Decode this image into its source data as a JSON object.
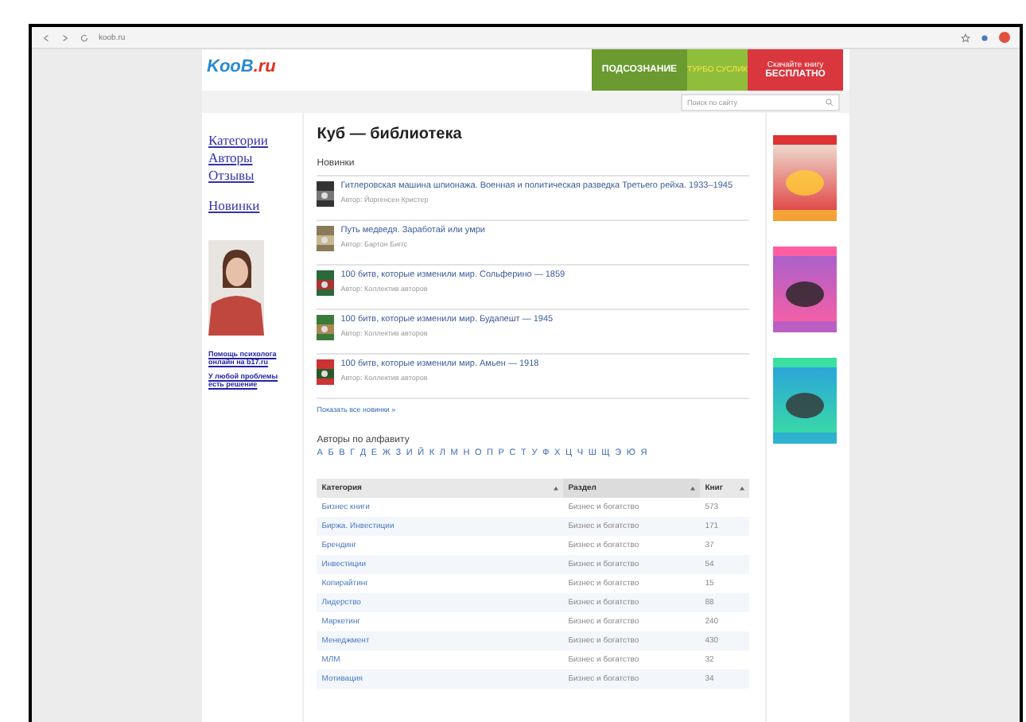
{
  "browser": {
    "url": "koob.ru"
  },
  "header": {
    "logo_main": "KooB",
    "logo_suffix": ".ru",
    "banner": {
      "tagline": "ПОДСОЗНАНИЕ",
      "middle": "ТУРБО СУСЛИК",
      "cta_line1": "Скачайте книгу",
      "cta_line2": "БЕСПЛАТНО"
    }
  },
  "search": {
    "placeholder": "Поиск по сайту"
  },
  "sidebar": {
    "links": [
      "Категории",
      "Авторы",
      "Отзывы"
    ],
    "news_link": "Новинки",
    "promo_links": [
      "Помощь психолога онлайн на b17.ru",
      "У любой проблемы есть решение"
    ]
  },
  "main": {
    "title": "Куб — библиотека",
    "news_heading": "Новинки",
    "books": [
      {
        "title": "Гитлеровская машина шпионажа. Военная и политическая разведка Третьего рейха. 1933–1945",
        "author": "Автор: Йоргенсен Кристер"
      },
      {
        "title": "Путь медведя. Заработай или умри",
        "author": "Автор: Бартон Биггс"
      },
      {
        "title": "100 битв, которые изменили мир. Сольферино — 1859",
        "author": "Автор: Коллектив авторов"
      },
      {
        "title": "100 битв, которые изменили мир. Будапешт — 1945",
        "author": "Автор: Коллектив авторов"
      },
      {
        "title": "100 битв, которые изменили мир. Амьен — 1918",
        "author": "Автор: Коллектив авторов"
      }
    ],
    "show_all": "Показать все новинки »",
    "authors_heading": "Авторы по алфавиту",
    "letters": [
      "А",
      "Б",
      "В",
      "Г",
      "Д",
      "Е",
      "Ж",
      "З",
      "И",
      "Й",
      "К",
      "Л",
      "М",
      "Н",
      "О",
      "П",
      "Р",
      "С",
      "Т",
      "У",
      "Ф",
      "Х",
      "Ц",
      "Ч",
      "Ш",
      "Щ",
      "Э",
      "Ю",
      "Я"
    ],
    "table": {
      "columns": [
        "Категория",
        "Раздел",
        "Книг"
      ],
      "rows": [
        [
          "Бизнес книги",
          "Бизнес и богатство",
          "573"
        ],
        [
          "Биржа. Инвестиции",
          "Бизнес и богатство",
          "171"
        ],
        [
          "Брендинг",
          "Бизнес и богатство",
          "37"
        ],
        [
          "Инвестиции",
          "Бизнес и богатство",
          "54"
        ],
        [
          "Копирайтинг",
          "Бизнес и богатство",
          "15"
        ],
        [
          "Лидерство",
          "Бизнес и богатство",
          "88"
        ],
        [
          "Маркетинг",
          "Бизнес и богатство",
          "240"
        ],
        [
          "Менеджмент",
          "Бизнес и богатство",
          "430"
        ],
        [
          "МЛМ",
          "Бизнес и богатство",
          "32"
        ],
        [
          "Мотивация",
          "Бизнес и богатство",
          "34"
        ]
      ]
    }
  }
}
